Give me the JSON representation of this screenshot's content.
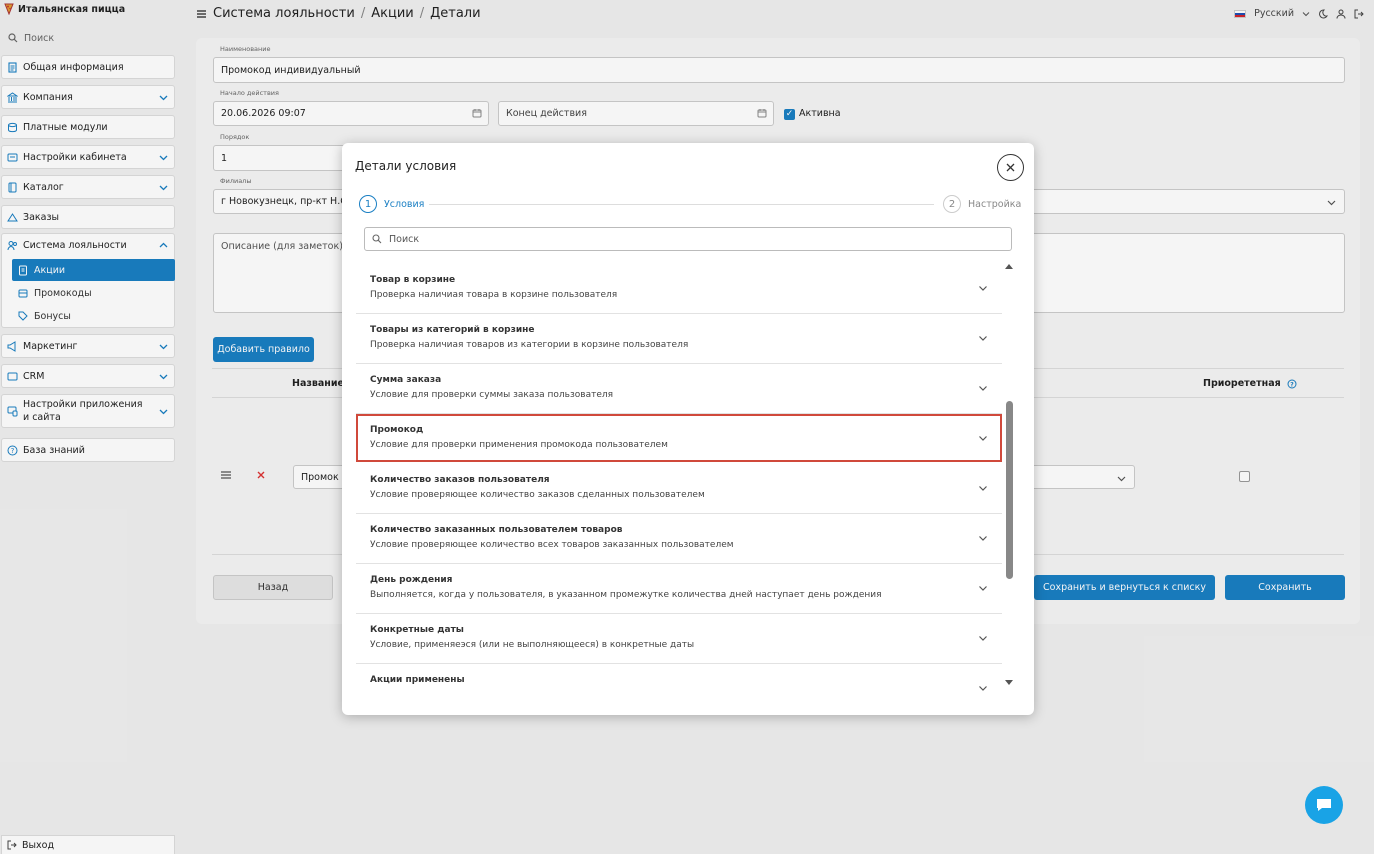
{
  "sidebar": {
    "brand": "Итальянская пицца",
    "search_placeholder": "Поиск",
    "items": [
      {
        "label": "Общая информация"
      },
      {
        "label": "Компания"
      },
      {
        "label": "Платные модули"
      },
      {
        "label": "Настройки кабинета"
      },
      {
        "label": "Каталог"
      },
      {
        "label": "Заказы"
      }
    ],
    "loyalty": {
      "label": "Система лояльности",
      "sub": [
        {
          "label": "Акции"
        },
        {
          "label": "Промокоды"
        },
        {
          "label": "Бонусы"
        }
      ]
    },
    "items2": [
      {
        "label": "Маркетинг"
      },
      {
        "label": "CRM"
      },
      {
        "label": "Настройки приложения и сайта"
      },
      {
        "label": "База знаний"
      }
    ],
    "logout": "Выход"
  },
  "header": {
    "crumb1": "Система лояльности",
    "crumb2": "Акции",
    "crumb3": "Детали",
    "separator": "/",
    "language": "Русский"
  },
  "form": {
    "name_label": "Наименование",
    "name_value": "Промокод индивидуальный",
    "start_label": "Начало действия",
    "start_value": "20.06.2026 09:07",
    "end_placeholder": "Конец действия",
    "active_label": "Активна",
    "order_label": "Порядок",
    "order_value": "1",
    "branches_label": "Филиалы",
    "branches_value": "г Новокузнецк, пр-кт Н.С.",
    "description_placeholder": "Описание (для заметок)",
    "add_rule": "Добавить правило",
    "col_name": "Название",
    "col_priority": "Приорететная",
    "rule_value": "Промок",
    "back": "Назад",
    "save_return": "Сохранить и вернуться к списку",
    "save": "Сохранить"
  },
  "modal": {
    "title": "Детали условия",
    "step1_num": "1",
    "step1_label": "Условия",
    "step2_num": "2",
    "step2_label": "Настройка",
    "search_placeholder": "Поиск",
    "conditions": [
      {
        "title": "Товар в корзине",
        "desc": "Проверка наличиая товара в корзине пользователя"
      },
      {
        "title": "Товары из категорий в корзине",
        "desc": "Проверка наличиая товаров из категории в корзине пользователя"
      },
      {
        "title": "Сумма заказа",
        "desc": "Условие для проверки суммы заказа пользователя"
      },
      {
        "title": "Промокод",
        "desc": "Условие для проверки применения промокода пользователем"
      },
      {
        "title": "Количество заказов пользователя",
        "desc": "Условие проверяющее количество заказов сделанных пользователем"
      },
      {
        "title": "Количество заказанных пользователем товаров",
        "desc": "Условие проверяющее количество всех товаров заказанных пользователем"
      },
      {
        "title": "День рождения",
        "desc": "Выполняется, когда у пользователя, в указанном промежутке количества дней наступает день рождения"
      },
      {
        "title": "Конкретные даты",
        "desc": "Условие, применяеэся (или не выполняющееся) в конкретные даты"
      },
      {
        "title": "Акции применены",
        "desc": ""
      }
    ]
  },
  "colors": {
    "accent": "#1a7fc3",
    "highlight": "#d0493b",
    "chat": "#19a3e6"
  }
}
